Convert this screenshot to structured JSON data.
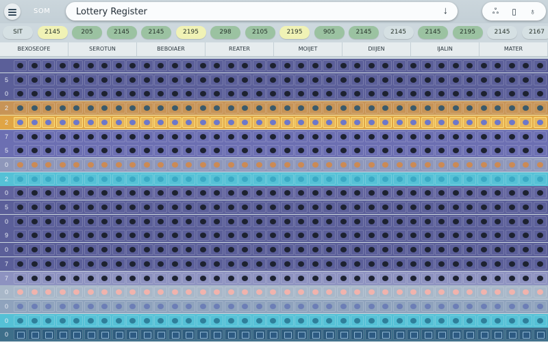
{
  "app": {
    "menu_label": "Menu",
    "section": "SOM",
    "title": "Lottery Register",
    "download_icon": "down-arrow-icon",
    "action_icons": [
      "people-icon",
      "bookmark-icon",
      "user-icon"
    ]
  },
  "chips": [
    {
      "label": "SIT",
      "color": "#d5e0e3"
    },
    {
      "label": "2145",
      "color": "#f0f2b5"
    },
    {
      "label": "205",
      "color": "#9bc2a1"
    },
    {
      "label": "2145",
      "color": "#9bc2a1"
    },
    {
      "label": "2145",
      "color": "#9bc2a1"
    },
    {
      "label": "2195",
      "color": "#f0f2b5"
    },
    {
      "label": "298",
      "color": "#9bc2a1"
    },
    {
      "label": "2105",
      "color": "#9bc2a1"
    },
    {
      "label": "2195",
      "color": "#f0f2b5"
    },
    {
      "label": "905",
      "color": "#9bc2a1"
    },
    {
      "label": "2145",
      "color": "#9bc2a1"
    },
    {
      "label": "2145",
      "color": "#d5e0e3"
    },
    {
      "label": "2145",
      "color": "#9bc2a1"
    },
    {
      "label": "2195",
      "color": "#9bc2a1"
    },
    {
      "label": "2145",
      "color": "#d5e0e3"
    },
    {
      "label": "2167",
      "color": "#d5e0e3"
    }
  ],
  "tabs": [
    "BEXOSEOFE",
    "SEROTUN",
    "BEBOIAER",
    "REATER",
    "MOIJET",
    "DIIJEN",
    "IJALIN",
    "MATER"
  ],
  "grid": {
    "columns": 38,
    "rows": [
      {
        "label": "",
        "bg": "#5b5f99",
        "dot": "#1d2230",
        "style": "dark"
      },
      {
        "label": "5",
        "bg": "#5b5f99",
        "dot": "#1d2230",
        "style": "dark"
      },
      {
        "label": "0",
        "bg": "#5b5f99",
        "dot": "#1d2230",
        "style": "dark"
      },
      {
        "label": "2",
        "bg": "#c79457",
        "dot": "#3b5a6a",
        "style": "orange"
      },
      {
        "label": "2",
        "bg": "#e0a545",
        "dot": "#6d78c9",
        "style": "gold"
      },
      {
        "label": "7",
        "bg": "#6c6fb2",
        "dot": "#1d2230",
        "style": "dark"
      },
      {
        "label": "5",
        "bg": "#6c6fb2",
        "dot": "#1d2230",
        "style": "dark"
      },
      {
        "label": "0",
        "bg": "#8e97ba",
        "dot": "#cb8a55",
        "style": "peach"
      },
      {
        "label": "2",
        "bg": "#55c1d6",
        "dot": "#3aa9c4",
        "style": "cyan"
      },
      {
        "label": "0",
        "bg": "#62649e",
        "dot": "#1d2230",
        "style": "dark"
      },
      {
        "label": "5",
        "bg": "#5b5f99",
        "dot": "#1d2230",
        "style": "dark"
      },
      {
        "label": "0",
        "bg": "#5b5f99",
        "dot": "#1d2230",
        "style": "dark"
      },
      {
        "label": "9",
        "bg": "#5b5f99",
        "dot": "#1d2230",
        "style": "dark"
      },
      {
        "label": "0",
        "bg": "#5b5f99",
        "dot": "#1d2230",
        "style": "dark"
      },
      {
        "label": "7",
        "bg": "#5b5f99",
        "dot": "#1d2230",
        "style": "dark"
      },
      {
        "label": "7",
        "bg": "#8d92c0",
        "dot": "#1d2230",
        "style": "dark"
      },
      {
        "label": "0",
        "bg": "#a8b7c8",
        "dot": "#f0b3ad",
        "style": "pink"
      },
      {
        "label": "0",
        "bg": "#8fa3bd",
        "dot": "#6c7eb6",
        "style": "light"
      },
      {
        "label": "0",
        "bg": "#55c1d6",
        "dot": "#2f7f9a",
        "style": "cyan"
      },
      {
        "label": "0",
        "bg": "#3e6f8a",
        "dot": "#2d5a82",
        "style": "square"
      }
    ]
  }
}
